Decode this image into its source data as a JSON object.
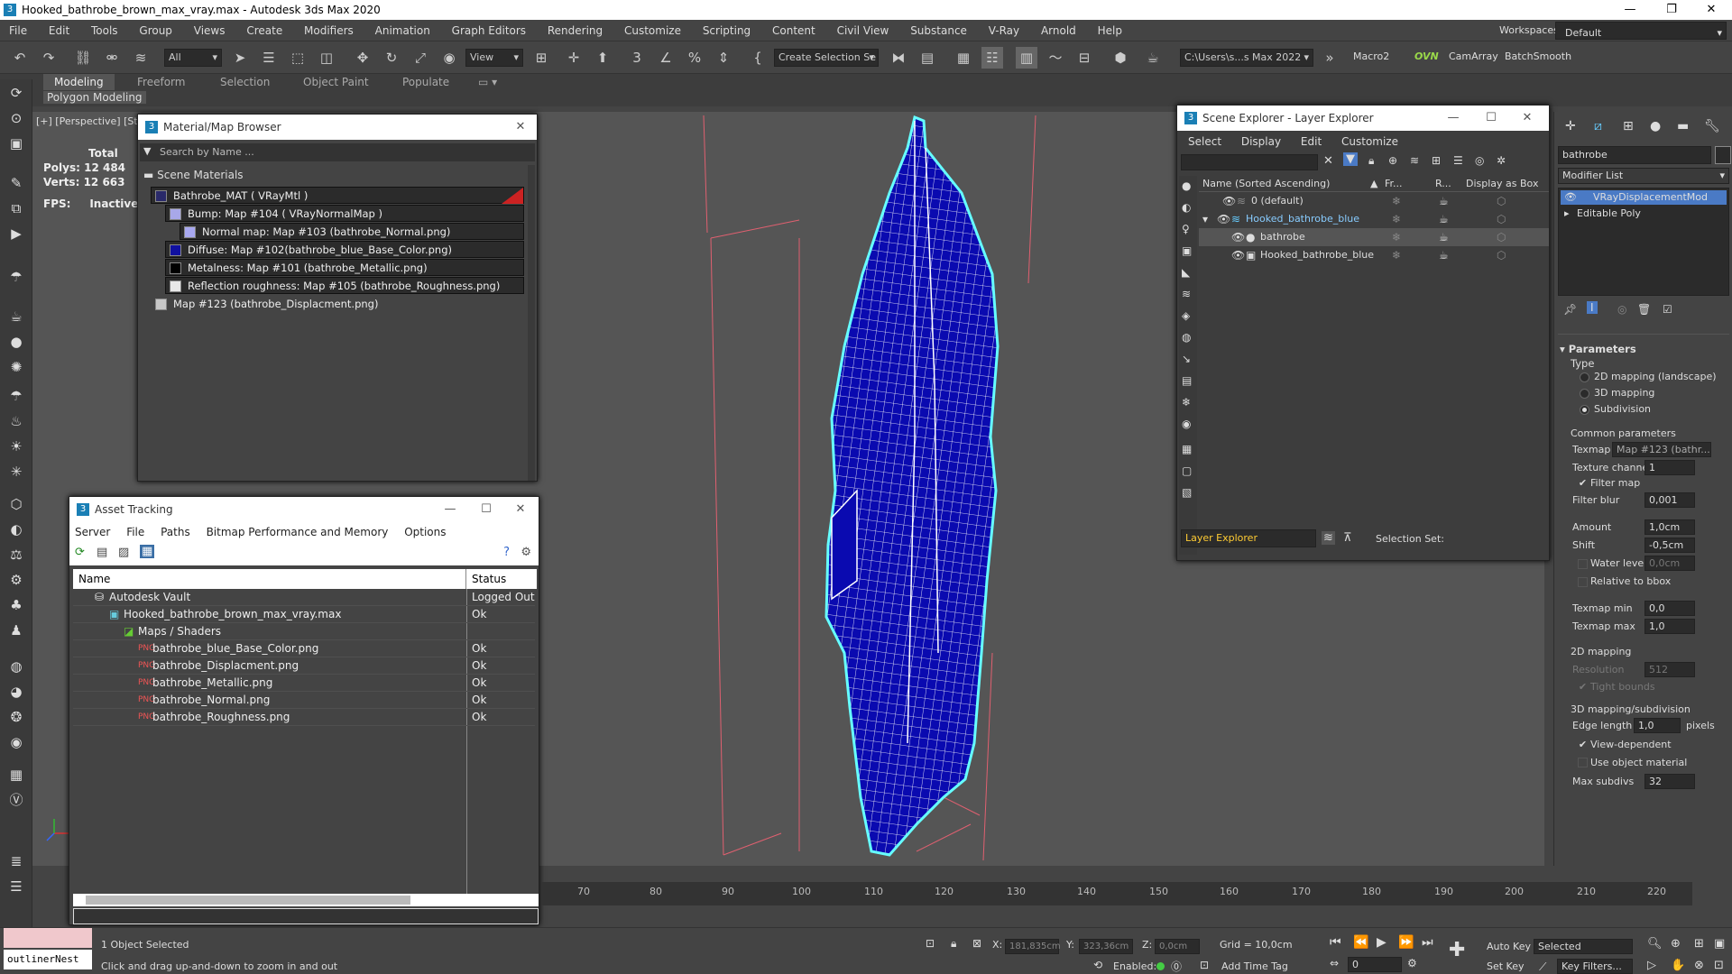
{
  "window": {
    "title": "Hooked_bathrobe_brown_max_vray.max - Autodesk 3ds Max 2020",
    "minimize": "—",
    "maximize": "❐",
    "close": "✕"
  },
  "menu": [
    "File",
    "Edit",
    "Tools",
    "Group",
    "Views",
    "Create",
    "Modifiers",
    "Animation",
    "Graph Editors",
    "Rendering",
    "Customize",
    "Scripting",
    "Content",
    "Civil View",
    "Substance",
    "V-Ray",
    "Arnold",
    "Help"
  ],
  "workspace": {
    "label": "Workspaces:",
    "value": "Default"
  },
  "toolbar": {
    "selection_filter": "All",
    "ref_coord": "View",
    "selection_set": "Create Selection Se",
    "project_path": "C:\\Users\\s...s Max 2022",
    "macros": [
      "Macro2",
      "OVN",
      "CamArray",
      "BatchSmooth"
    ]
  },
  "ribbon": {
    "tabs": [
      "Modeling",
      "Freeform",
      "Selection",
      "Object Paint",
      "Populate"
    ],
    "active": "Modeling",
    "sub": "Polygon Modeling"
  },
  "viewport": {
    "label": "[+] [Perspective] [St",
    "stats": {
      "total": "Total",
      "polys_label": "Polys:",
      "polys": "12 484",
      "verts_label": "Verts:",
      "verts": "12 663",
      "fps_label": "FPS:",
      "fps": "Inactive"
    }
  },
  "material_browser": {
    "title": "Material/Map Browser",
    "search_placeholder": "Search by Name ...",
    "section": "Scene Materials",
    "items": [
      {
        "label": "Bathrobe_MAT  ( VRayMtl )",
        "swatch": "#2a2a6a"
      },
      {
        "label": "Bump: Map #104  ( VRayNormalMap )",
        "swatch": "#a8a8e8"
      },
      {
        "label": "Normal map: Map #103 (bathrobe_Normal.png)",
        "swatch": "#a8a8f0"
      },
      {
        "label": "Diffuse: Map #102(bathrobe_blue_Base_Color.png)",
        "swatch": "#1010a0"
      },
      {
        "label": "Metalness: Map #101 (bathrobe_Metallic.png)",
        "swatch": "#000000"
      },
      {
        "label": "Reflection roughness: Map #105 (bathrobe_Roughness.png)",
        "swatch": "#e8e8e8"
      },
      {
        "label": "Map #123 (bathrobe_Displacment.png)",
        "swatch": "#c8c8c8"
      }
    ]
  },
  "asset_tracking": {
    "title": "Asset Tracking",
    "menu": [
      "Server",
      "File",
      "Paths",
      "Bitmap Performance and Memory",
      "Options"
    ],
    "columns": [
      "Name",
      "Status"
    ],
    "rows": [
      {
        "name": "Autodesk Vault",
        "status": "Logged Out"
      },
      {
        "name": "Hooked_bathrobe_brown_max_vray.max",
        "status": "Ok"
      },
      {
        "name": "Maps / Shaders",
        "status": ""
      },
      {
        "name": "bathrobe_blue_Base_Color.png",
        "status": "Ok"
      },
      {
        "name": "bathrobe_Displacment.png",
        "status": "Ok"
      },
      {
        "name": "bathrobe_Metallic.png",
        "status": "Ok"
      },
      {
        "name": "bathrobe_Normal.png",
        "status": "Ok"
      },
      {
        "name": "bathrobe_Roughness.png",
        "status": "Ok"
      }
    ]
  },
  "scene_explorer": {
    "title": "Scene Explorer - Layer Explorer",
    "menu": [
      "Select",
      "Display",
      "Edit",
      "Customize"
    ],
    "columns": [
      "Name (Sorted Ascending)",
      "Fr...",
      "R...",
      "Display as Box"
    ],
    "rows": [
      {
        "name": "0 (default)"
      },
      {
        "name": "Hooked_bathrobe_blue"
      },
      {
        "name": "bathrobe"
      },
      {
        "name": "Hooked_bathrobe_blue"
      }
    ],
    "footer_left": "Layer Explorer",
    "footer_right": "Selection Set:"
  },
  "command_panel": {
    "object_name": "bathrobe",
    "modifier_list": "Modifier List",
    "stack": [
      "VRayDisplacementMod",
      "Editable Poly"
    ],
    "rollout": "Parameters",
    "type_label": "Type",
    "types": [
      "2D mapping (landscape)",
      "3D mapping",
      "Subdivision"
    ],
    "common": "Common parameters",
    "texmap_label": "Texmap",
    "texmap": "Map #123 (bathr...",
    "texture_channel_label": "Texture channel",
    "texture_channel": "1",
    "filter_map": "Filter map",
    "filter_blur_label": "Filter blur",
    "filter_blur": "0,001",
    "amount_label": "Amount",
    "amount": "1,0cm",
    "shift_label": "Shift",
    "shift": "-0,5cm",
    "water_level_label": "Water level",
    "water_level": "0,0cm",
    "relative_bbox": "Relative to bbox",
    "texmap_min_label": "Texmap min",
    "texmap_min": "0,0",
    "texmap_max_label": "Texmap max",
    "texmap_max": "1,0",
    "mapping2d": "2D mapping",
    "resolution_label": "Resolution",
    "resolution": "512",
    "tight_bounds": "Tight bounds",
    "mapping3d": "3D mapping/subdivision",
    "edge_length_label": "Edge length",
    "edge_length": "1,0",
    "pixels": "pixels",
    "view_dependent": "View-dependent",
    "use_object_material": "Use object material",
    "max_subdivs_label": "Max subdivs",
    "max_subdivs": "32"
  },
  "timeline": {
    "ticks": [
      "70",
      "80",
      "90",
      "100",
      "110",
      "120",
      "130",
      "140",
      "150",
      "160",
      "170",
      "180",
      "190",
      "200",
      "210",
      "220"
    ]
  },
  "status": {
    "maxscript": "outlinerNest",
    "selected": "1 Object Selected",
    "prompt": "Click and drag up-and-down to zoom in and out",
    "x_label": "X:",
    "x": "181,835cm",
    "y_label": "Y:",
    "y": "323,36cm",
    "z_label": "Z:",
    "z": "0,0cm",
    "grid": "Grid = 10,0cm",
    "enabled": "Enabled:",
    "add_time_tag": "Add Time Tag",
    "frame": "0",
    "auto_key": "Auto Key",
    "set_key": "Set Key",
    "key_mode": "Selected",
    "key_filters": "Key Filters..."
  }
}
